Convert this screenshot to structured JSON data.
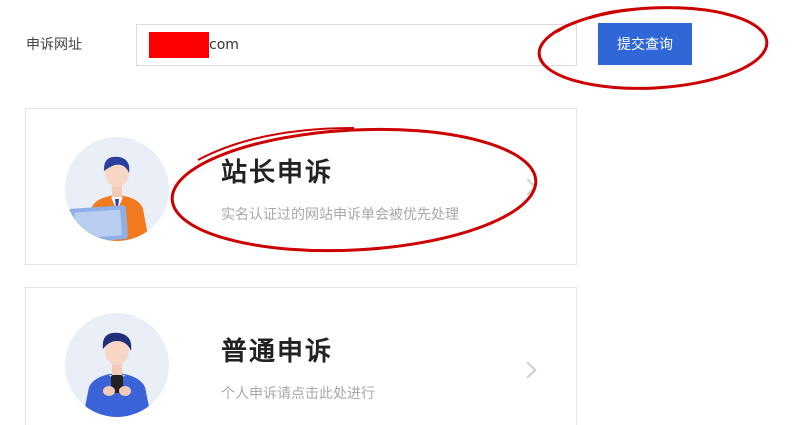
{
  "form": {
    "label": "申诉网址",
    "url_value": "com",
    "submit_label": "提交查询"
  },
  "cards": [
    {
      "title": "站长申诉",
      "description": "实名认证过的网站申诉单会被优先处理",
      "icon": "webmaster-avatar-icon"
    },
    {
      "title": "普通申诉",
      "description": "个人申诉请点击此处进行",
      "icon": "user-avatar-icon"
    }
  ],
  "colors": {
    "accent": "#2f68d6",
    "annotation": "#cc0000",
    "redaction": "#ff0000"
  }
}
